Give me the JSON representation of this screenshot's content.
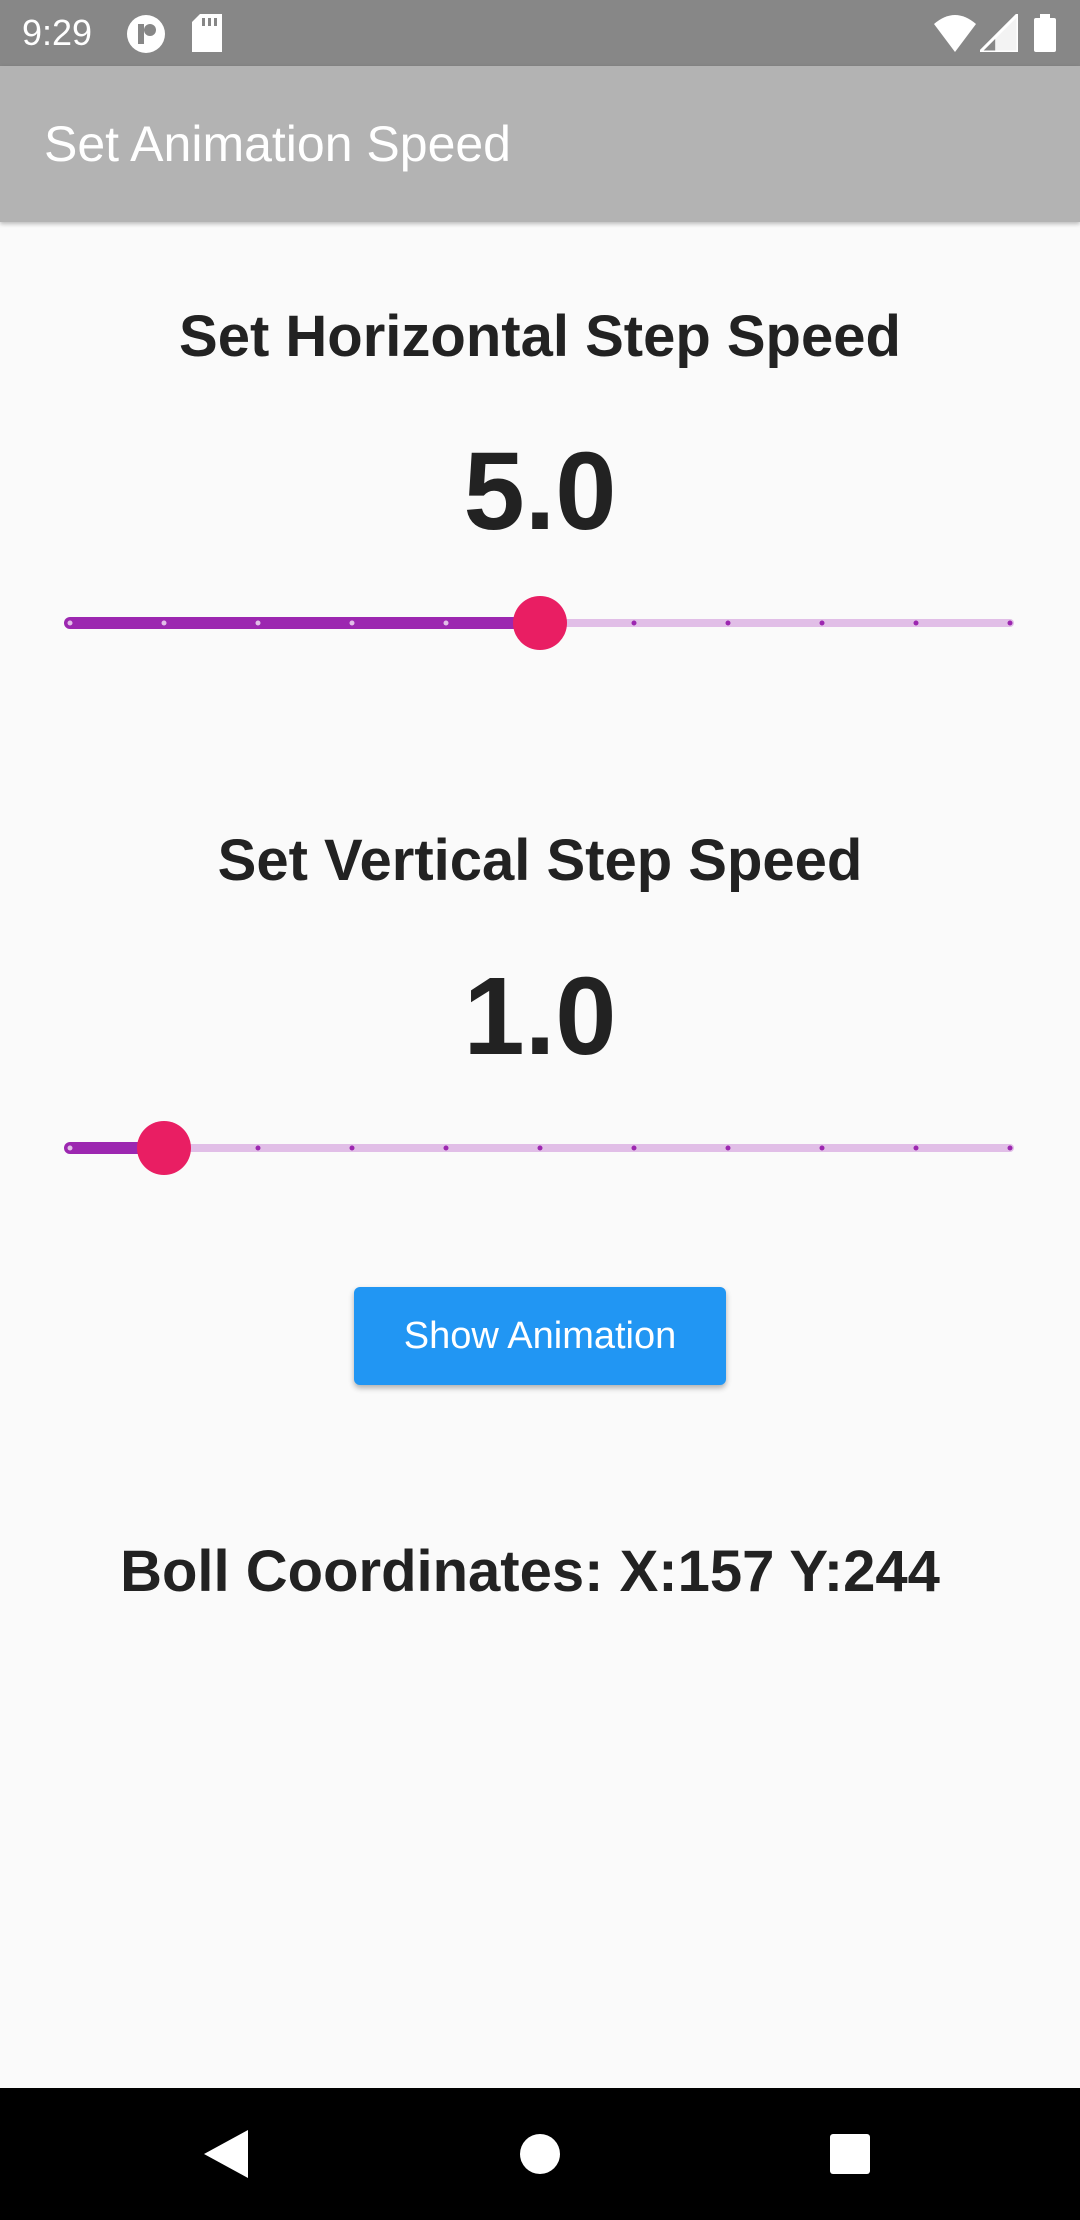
{
  "status_bar": {
    "time": "9:29",
    "left_icons": [
      "app-notification-icon",
      "sd-card-icon"
    ],
    "right_icons": [
      "wifi-icon",
      "signal-icon",
      "battery-icon"
    ]
  },
  "app_bar": {
    "title": "Set Animation Speed"
  },
  "horizontal": {
    "title": "Set Horizontal Step Speed",
    "value": "5.0",
    "slider": {
      "min": 0,
      "max": 10,
      "divisions": 10,
      "value": 5
    }
  },
  "vertical": {
    "title": "Set Vertical Step Speed",
    "value": "1.0",
    "slider": {
      "min": 0,
      "max": 10,
      "divisions": 10,
      "value": 1
    }
  },
  "button": {
    "label": "Show Animation"
  },
  "coordinates": {
    "text": "Boll Coordinates: X:157 Y:244"
  },
  "colors": {
    "accent": "#9c27b0",
    "accent_light": "#e1bee7",
    "thumb": "#e91e63",
    "button": "#2196f3",
    "app_bar": "#b3b3b3",
    "status_bar": "#878787"
  },
  "nav_bar": {
    "icons": [
      "back-icon",
      "home-icon",
      "recents-icon"
    ]
  }
}
